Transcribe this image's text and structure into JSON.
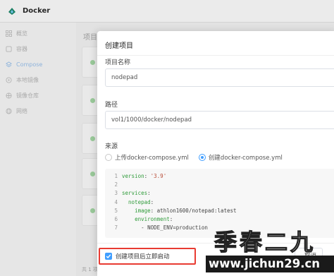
{
  "app": {
    "title": "Docker",
    "accent_color": "#409eff"
  },
  "sidebar": {
    "items": [
      {
        "label": "概览",
        "icon": "grid-icon"
      },
      {
        "label": "容器",
        "icon": "box-icon"
      },
      {
        "label": "Compose",
        "icon": "layers-icon",
        "active": true
      },
      {
        "label": "本地镜像",
        "icon": "disc-icon"
      },
      {
        "label": "镜像仓库",
        "icon": "database-icon"
      },
      {
        "label": "网络",
        "icon": "network-icon"
      }
    ]
  },
  "background": {
    "section_title": "项目",
    "footer_text": "共 1 项"
  },
  "dialog": {
    "title": "创建项目",
    "name_label": "项目名称",
    "name_value": "nodepad",
    "path_label": "路径",
    "path_value": "vol1/1000/docker/nodepad",
    "source_label": "来源",
    "source_options": [
      {
        "label": "上传docker-compose.yml",
        "checked": false
      },
      {
        "label": "创建docker-compose.yml",
        "checked": true
      }
    ],
    "code_lines": [
      {
        "n": "1",
        "key": "version",
        "sep": ": ",
        "val": "'3.9'",
        "indent": ""
      },
      {
        "n": "2",
        "key": "",
        "sep": "",
        "val": "",
        "indent": ""
      },
      {
        "n": "3",
        "key": "services",
        "sep": ":",
        "val": "",
        "indent": ""
      },
      {
        "n": "4",
        "key": "notepad",
        "sep": ":",
        "val": "",
        "indent": "  "
      },
      {
        "n": "5",
        "key": "image",
        "sep": ": ",
        "val": "athlon1600/notepad:latest",
        "indent": "    "
      },
      {
        "n": "6",
        "key": "environment",
        "sep": ":",
        "val": "",
        "indent": "    "
      },
      {
        "n": "7",
        "key": "",
        "sep": "",
        "val": "- NODE_ENV=production",
        "indent": "      "
      }
    ],
    "start_after_create_label": "创建项目后立即启动",
    "start_after_create_checked": true,
    "cancel_label": "取消"
  },
  "watermark": {
    "cn_text": "季春二九",
    "url_text": "www.jichun29.cn"
  }
}
